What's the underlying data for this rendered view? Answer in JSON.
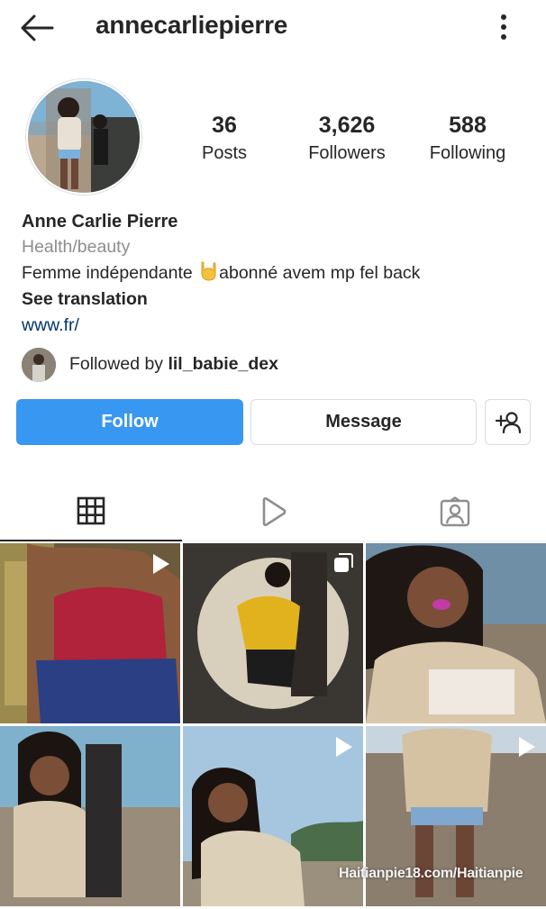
{
  "header": {
    "username": "annecarliepierre",
    "back_icon": "arrow-left-icon",
    "more_icon": "more-vertical-icon"
  },
  "stats": {
    "posts_count": "36",
    "posts_label": "Posts",
    "followers_count": "3,626",
    "followers_label": "Followers",
    "following_count": "588",
    "following_label": "Following"
  },
  "bio": {
    "name": "Anne Carlie Pierre",
    "category": "Health/beauty",
    "text_before": "Femme indépendante ",
    "text_after": "abonné avem mp fel back",
    "see_translation": "See translation",
    "link": "www.fr/"
  },
  "followed_by": {
    "prefix": "Followed by ",
    "user": "lil_babie_dex"
  },
  "actions": {
    "follow": "Follow",
    "message": "Message",
    "add_icon": "add-person-icon"
  },
  "tabs": [
    {
      "name": "grid",
      "icon": "grid-icon",
      "active": true
    },
    {
      "name": "reels",
      "icon": "play-icon",
      "active": false
    },
    {
      "name": "tagged",
      "icon": "tagged-person-icon",
      "active": false
    }
  ],
  "colors": {
    "accent": "#3897f0",
    "link": "#00376b",
    "text": "#262626",
    "muted": "#8e8e8e"
  },
  "posts": [
    {
      "type": "reel",
      "icon": "play-icon"
    },
    {
      "type": "carousel",
      "icon": "carousel-icon"
    },
    {
      "type": "photo"
    },
    {
      "type": "photo"
    },
    {
      "type": "reel",
      "icon": "play-icon"
    },
    {
      "type": "reel",
      "icon": "play-icon"
    }
  ],
  "watermark": "Haitianpie18.com/Haitianpie"
}
